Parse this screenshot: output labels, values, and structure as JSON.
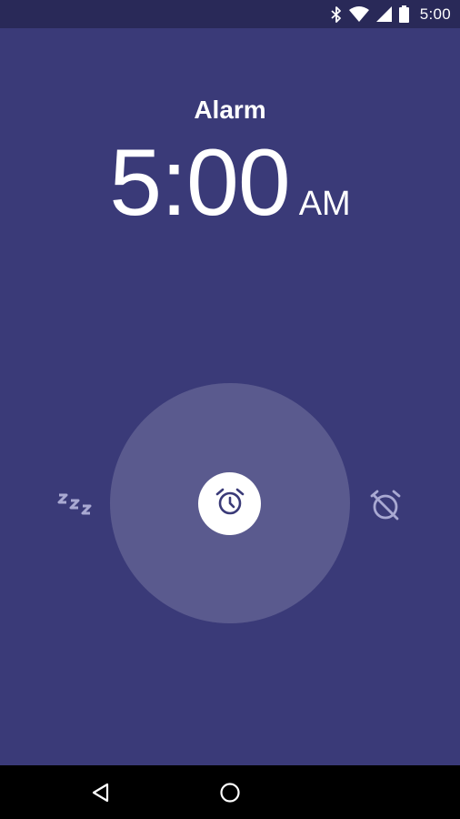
{
  "status_bar": {
    "time": "5:00",
    "icons": [
      "bluetooth-icon",
      "wifi-icon",
      "signal-icon",
      "battery-icon"
    ]
  },
  "alarm": {
    "title": "Alarm",
    "time": "5:00",
    "ampm": "AM"
  },
  "actions": {
    "snooze_icon": "snooze-icon",
    "dismiss_icon": "alarm-off-icon",
    "handle_icon": "alarm-clock-icon"
  },
  "nav_bar": {
    "icons": [
      "back-icon",
      "home-icon"
    ]
  },
  "colors": {
    "background": "#3a3a78",
    "status_bar": "#292958",
    "dial": "#5a5a8e",
    "icon_muted": "#a9a9d2",
    "handle": "#ffffff",
    "handle_icon": "#3a3a78"
  }
}
